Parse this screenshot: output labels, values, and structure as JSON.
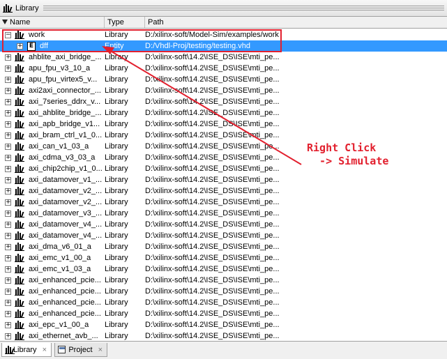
{
  "window": {
    "title": "Library",
    "icon": "library-icon"
  },
  "columns": {
    "name": "Name",
    "type": "Type",
    "path": "Path"
  },
  "rows": [
    {
      "name": "work",
      "type": "Library",
      "path": "D:/xilinx-soft/Model-Sim/examples/work",
      "expander": "−",
      "level": 0,
      "icon": "library-icon"
    },
    {
      "name": "dff",
      "type": "Entity",
      "path": "D:/Vhdl-Proj/testing/testing.vhd",
      "expander": "+",
      "level": 1,
      "icon": "entity-icon",
      "selected": true
    },
    {
      "name": "ahblite_axi_bridge_...",
      "type": "Library",
      "path": "D:\\xilinx-soft\\14.2\\ISE_DS\\ISE\\mti_pe...",
      "expander": "+",
      "level": 0,
      "icon": "library-icon"
    },
    {
      "name": "apu_fpu_v3_10_a",
      "type": "Library",
      "path": "D:\\xilinx-soft\\14.2\\ISE_DS\\ISE\\mti_pe...",
      "expander": "+",
      "level": 0,
      "icon": "library-icon"
    },
    {
      "name": "apu_fpu_virtex5_v...",
      "type": "Library",
      "path": "D:\\xilinx-soft\\14.2\\ISE_DS\\ISE\\mti_pe...",
      "expander": "+",
      "level": 0,
      "icon": "library-icon"
    },
    {
      "name": "axi2axi_connector_...",
      "type": "Library",
      "path": "D:\\xilinx-soft\\14.2\\ISE_DS\\ISE\\mti_pe...",
      "expander": "+",
      "level": 0,
      "icon": "library-icon"
    },
    {
      "name": "axi_7series_ddrx_v...",
      "type": "Library",
      "path": "D:\\xilinx-soft\\14.2\\ISE_DS\\ISE\\mti_pe...",
      "expander": "+",
      "level": 0,
      "icon": "library-icon"
    },
    {
      "name": "axi_ahblite_bridge_...",
      "type": "Library",
      "path": "D:\\xilinx-soft\\14.2\\ISE_DS\\ISE\\mti_pe...",
      "expander": "+",
      "level": 0,
      "icon": "library-icon"
    },
    {
      "name": "axi_apb_bridge_v1...",
      "type": "Library",
      "path": "D:\\xilinx-soft\\14.2\\ISE_DS\\ISE\\mti_pe...",
      "expander": "+",
      "level": 0,
      "icon": "library-icon"
    },
    {
      "name": "axi_bram_ctrl_v1_0...",
      "type": "Library",
      "path": "D:\\xilinx-soft\\14.2\\ISE_DS\\ISE\\mti_pe...",
      "expander": "+",
      "level": 0,
      "icon": "library-icon"
    },
    {
      "name": "axi_can_v1_03_a",
      "type": "Library",
      "path": "D:\\xilinx-soft\\14.2\\ISE_DS\\ISE\\mti_pe...",
      "expander": "+",
      "level": 0,
      "icon": "library-icon"
    },
    {
      "name": "axi_cdma_v3_03_a",
      "type": "Library",
      "path": "D:\\xilinx-soft\\14.2\\ISE_DS\\ISE\\mti_pe...",
      "expander": "+",
      "level": 0,
      "icon": "library-icon"
    },
    {
      "name": "axi_chip2chip_v1_0...",
      "type": "Library",
      "path": "D:\\xilinx-soft\\14.2\\ISE_DS\\ISE\\mti_pe...",
      "expander": "+",
      "level": 0,
      "icon": "library-icon"
    },
    {
      "name": "axi_datamover_v1_...",
      "type": "Library",
      "path": "D:\\xilinx-soft\\14.2\\ISE_DS\\ISE\\mti_pe...",
      "expander": "+",
      "level": 0,
      "icon": "library-icon"
    },
    {
      "name": "axi_datamover_v2_...",
      "type": "Library",
      "path": "D:\\xilinx-soft\\14.2\\ISE_DS\\ISE\\mti_pe...",
      "expander": "+",
      "level": 0,
      "icon": "library-icon"
    },
    {
      "name": "axi_datamover_v2_...",
      "type": "Library",
      "path": "D:\\xilinx-soft\\14.2\\ISE_DS\\ISE\\mti_pe...",
      "expander": "+",
      "level": 0,
      "icon": "library-icon"
    },
    {
      "name": "axi_datamover_v3_...",
      "type": "Library",
      "path": "D:\\xilinx-soft\\14.2\\ISE_DS\\ISE\\mti_pe...",
      "expander": "+",
      "level": 0,
      "icon": "library-icon"
    },
    {
      "name": "axi_datamover_v4_...",
      "type": "Library",
      "path": "D:\\xilinx-soft\\14.2\\ISE_DS\\ISE\\mti_pe...",
      "expander": "+",
      "level": 0,
      "icon": "library-icon"
    },
    {
      "name": "axi_datamover_v4_...",
      "type": "Library",
      "path": "D:\\xilinx-soft\\14.2\\ISE_DS\\ISE\\mti_pe...",
      "expander": "+",
      "level": 0,
      "icon": "library-icon"
    },
    {
      "name": "axi_dma_v6_01_a",
      "type": "Library",
      "path": "D:\\xilinx-soft\\14.2\\ISE_DS\\ISE\\mti_pe...",
      "expander": "+",
      "level": 0,
      "icon": "library-icon"
    },
    {
      "name": "axi_emc_v1_00_a",
      "type": "Library",
      "path": "D:\\xilinx-soft\\14.2\\ISE_DS\\ISE\\mti_pe...",
      "expander": "+",
      "level": 0,
      "icon": "library-icon"
    },
    {
      "name": "axi_emc_v1_03_a",
      "type": "Library",
      "path": "D:\\xilinx-soft\\14.2\\ISE_DS\\ISE\\mti_pe...",
      "expander": "+",
      "level": 0,
      "icon": "library-icon"
    },
    {
      "name": "axi_enhanced_pcie...",
      "type": "Library",
      "path": "D:\\xilinx-soft\\14.2\\ISE_DS\\ISE\\mti_pe...",
      "expander": "+",
      "level": 0,
      "icon": "library-icon"
    },
    {
      "name": "axi_enhanced_pcie...",
      "type": "Library",
      "path": "D:\\xilinx-soft\\14.2\\ISE_DS\\ISE\\mti_pe...",
      "expander": "+",
      "level": 0,
      "icon": "library-icon"
    },
    {
      "name": "axi_enhanced_pcie...",
      "type": "Library",
      "path": "D:\\xilinx-soft\\14.2\\ISE_DS\\ISE\\mti_pe...",
      "expander": "+",
      "level": 0,
      "icon": "library-icon"
    },
    {
      "name": "axi_enhanced_pcie...",
      "type": "Library",
      "path": "D:\\xilinx-soft\\14.2\\ISE_DS\\ISE\\mti_pe...",
      "expander": "+",
      "level": 0,
      "icon": "library-icon"
    },
    {
      "name": "axi_epc_v1_00_a",
      "type": "Library",
      "path": "D:\\xilinx-soft\\14.2\\ISE_DS\\ISE\\mti_pe...",
      "expander": "+",
      "level": 0,
      "icon": "library-icon"
    },
    {
      "name": "axi_ethernet_avb_...",
      "type": "Library",
      "path": "D:\\xilinx-soft\\14.2\\ISE_DS\\ISE\\mti_pe...",
      "expander": "+",
      "level": 0,
      "icon": "library-icon"
    }
  ],
  "annotation": {
    "line1": "Right Click",
    "line2": "  -> Simulate",
    "color": "#e2202e"
  },
  "tabs": [
    {
      "label": "Library",
      "icon": "library-icon",
      "close": "×",
      "active": true
    },
    {
      "label": "Project",
      "icon": "project-icon",
      "close": "×",
      "active": false
    }
  ],
  "colors": {
    "selection": "#3399ff",
    "annotation": "#e2202e"
  }
}
